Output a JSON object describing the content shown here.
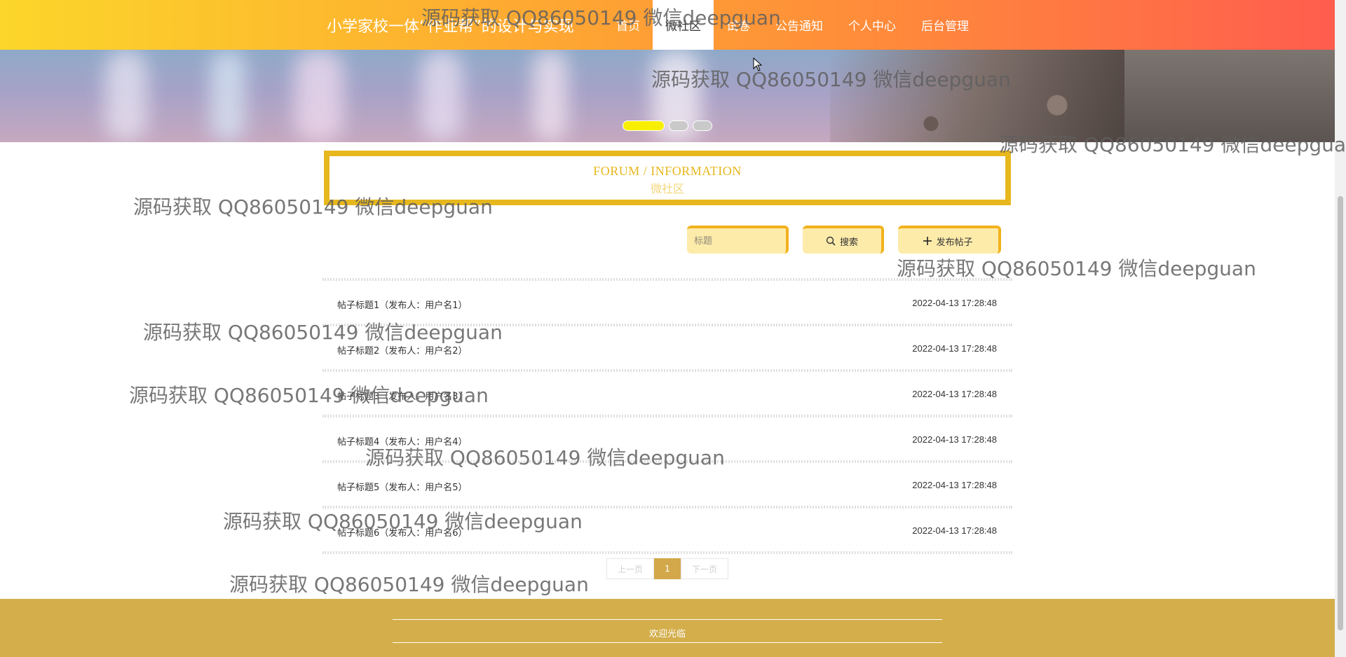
{
  "header": {
    "site_title": "小学家校一体“作业帮”的设计与实现",
    "nav": [
      "首页",
      "微社区",
      "试卷",
      "公告通知",
      "个人中心",
      "后台管理"
    ],
    "active_nav": "微社区"
  },
  "banner": {
    "slide_count": 3,
    "active_slide": 1
  },
  "section": {
    "en": "FORUM / INFORMATION",
    "zh": "微社区"
  },
  "search": {
    "placeholder": "标题",
    "search_label": "搜索",
    "add_label": "发布帖子",
    "search_icon": "search-icon",
    "add_icon": "plus-icon"
  },
  "posts": [
    {
      "title": "帖子标题1（发布人：用户名1）",
      "time": "2022-04-13 17:28:48"
    },
    {
      "title": "帖子标题2（发布人：用户名2）",
      "time": "2022-04-13 17:28:48"
    },
    {
      "title": "帖子标题3（发布人：用户名3）",
      "time": "2022-04-13 17:28:48"
    },
    {
      "title": "帖子标题4（发布人：用户名4）",
      "time": "2022-04-13 17:28:48"
    },
    {
      "title": "帖子标题5（发布人：用户名5）",
      "time": "2022-04-13 17:28:48"
    },
    {
      "title": "帖子标题6（发布人：用户名6）",
      "time": "2022-04-13 17:28:48"
    }
  ],
  "pagination": {
    "prev": "上一页",
    "current": "1",
    "next": "下一页"
  },
  "footer": {
    "welcome": "欢迎光临"
  },
  "watermark": "源码获取 QQ86050149 微信deepguan",
  "colors": {
    "accent_gold": "#e7b71e",
    "footer_gold": "#d3ae4b",
    "header_start": "#fcd62a",
    "header_end": "#ff5d4e"
  }
}
